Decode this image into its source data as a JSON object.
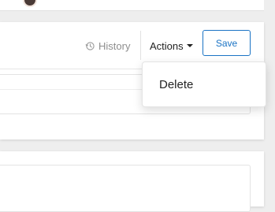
{
  "header": {
    "history_label": "History",
    "actions_label": "Actions",
    "save_label": "Save",
    "history_icon": "history-clock-icon",
    "actions_icon": "caret-down-icon"
  },
  "actions_menu": {
    "items": [
      {
        "label": "Delete"
      }
    ]
  },
  "colors": {
    "accent": "#1a73c4",
    "muted_text": "#8e8e8e",
    "background": "#eeeeee"
  }
}
